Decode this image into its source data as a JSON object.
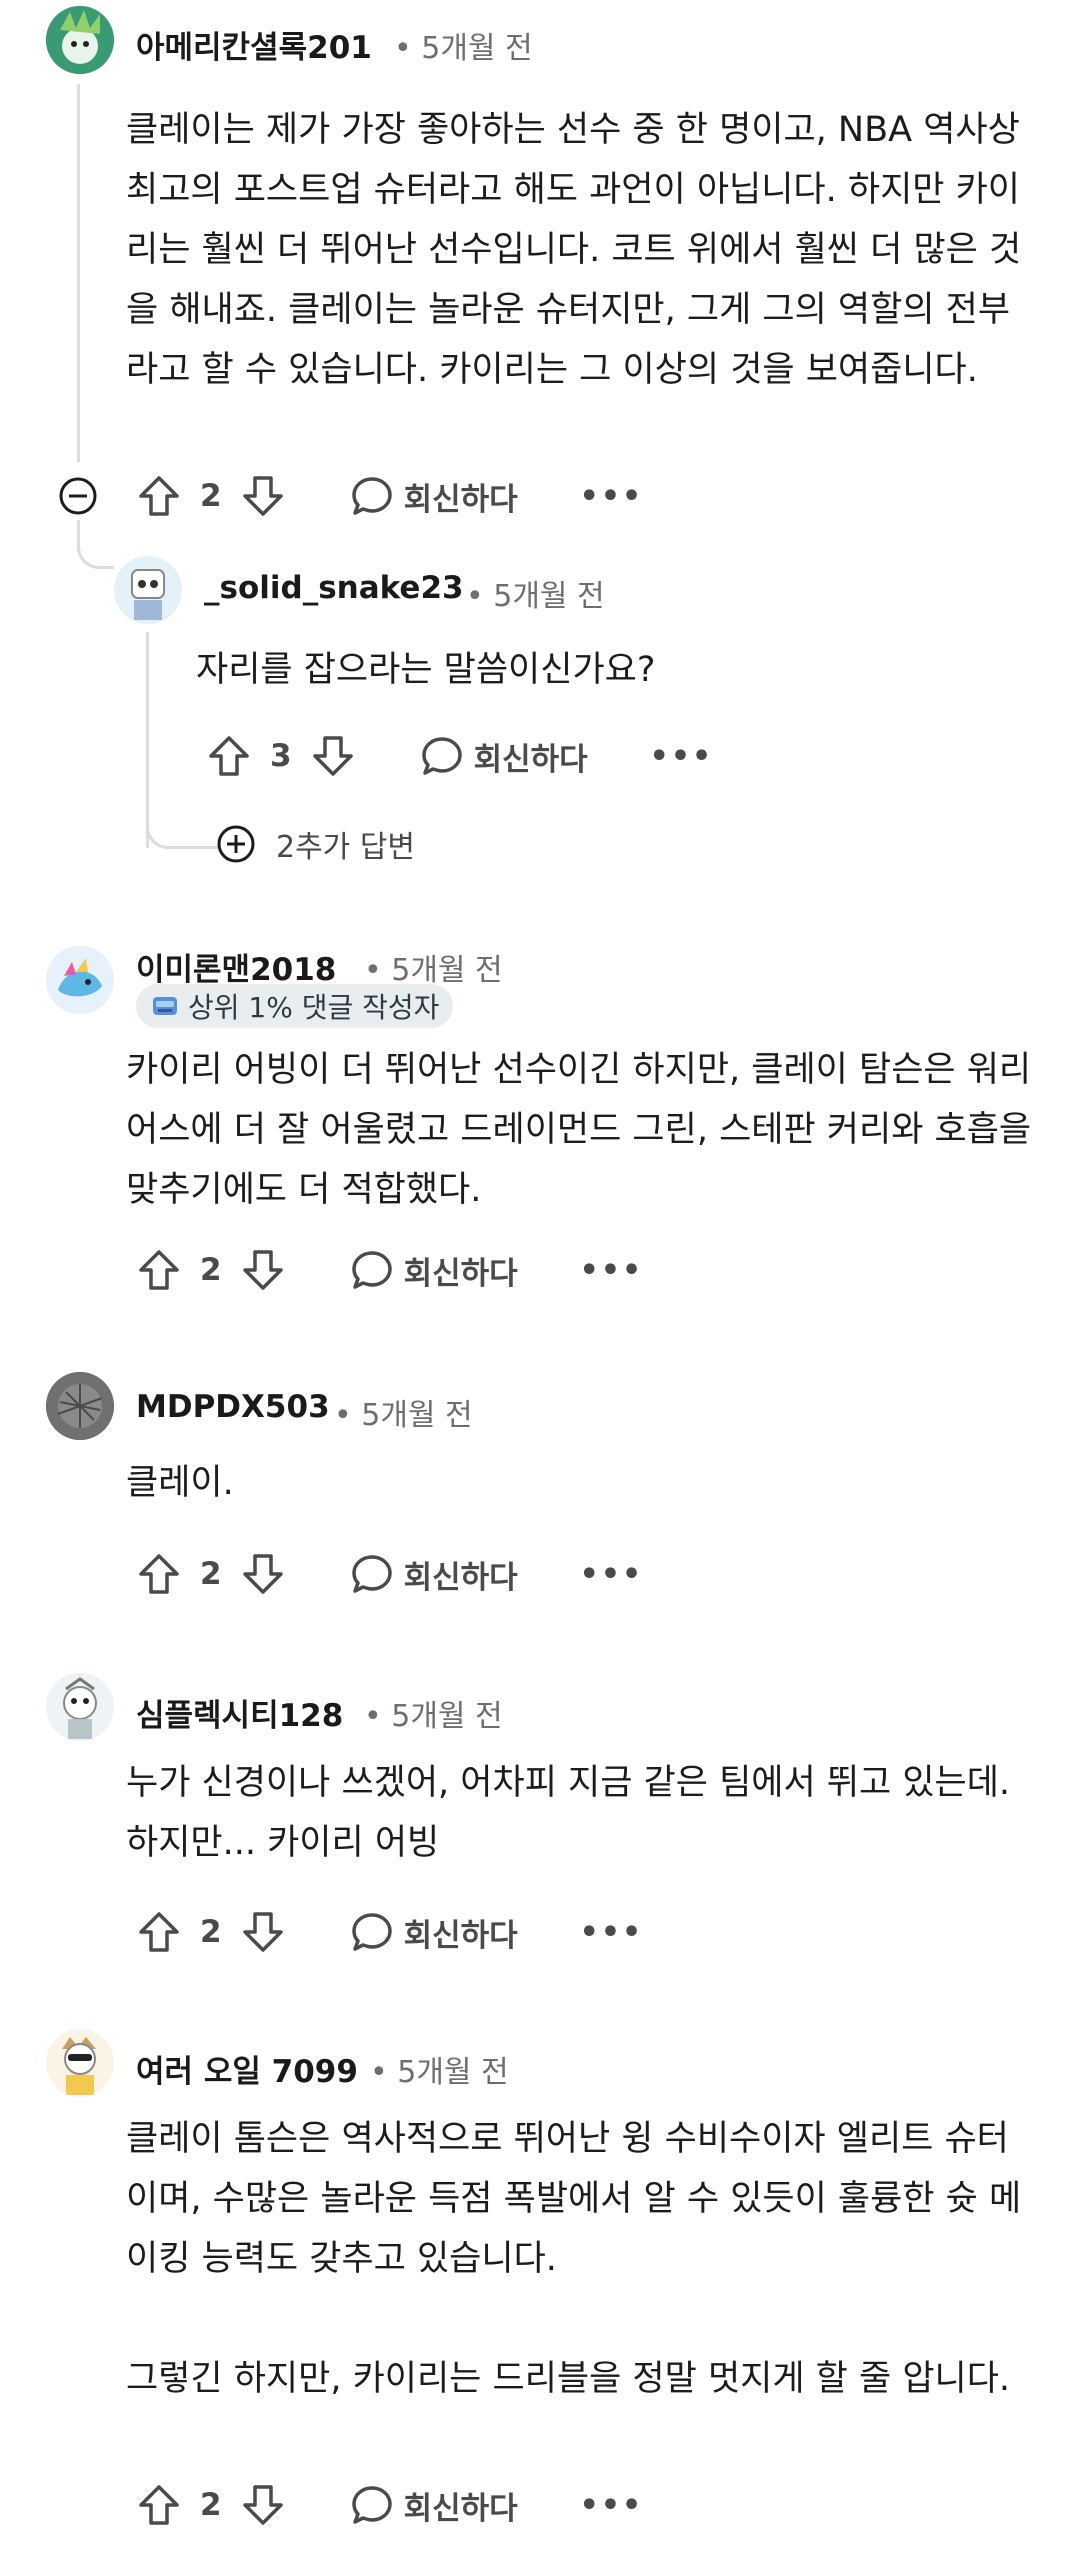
{
  "comments": [
    {
      "author": "아메리칸셜록201",
      "time": "• 5개월 전",
      "text": "클레이는 제가 가장 좋아하는 선수 중 한 명이고, NBA 역사상 최고의 포스트업 슈터라고 해도 과언이 아닙니다. 하지만 카이리는 훨씬 더 뛰어난 선수입니다. 코트 위에서 훨씬 더 많은 것을 해내죠. 클레이는 놀라운 슈터지만, 그게 그의 역할의 전부라고 할 수 있습니다. 카이리는 그 이상의 것을 보여줍니다.",
      "votes": "2",
      "reply_label": "회신하다",
      "more": "•••"
    },
    {
      "author": "_solid_snake23",
      "time": "• 5개월 전",
      "text": "자리를 잡으라는 말씀이신가요?",
      "votes": "3",
      "reply_label": "회신하다",
      "more": "•••",
      "more_replies": "2추가 답변"
    },
    {
      "author": "이미론맨2018",
      "time": "• 5개월 전",
      "flair": "상위 1% 댓글 작성자",
      "text": "카이리 어빙이 더 뛰어난 선수이긴 하지만, 클레이 탐슨은 워리어스에 더 잘 어울렸고 드레이먼드 그린, 스테판 커리와 호흡을 맞추기에도 더 적합했다.",
      "votes": "2",
      "reply_label": "회신하다",
      "more": "•••"
    },
    {
      "author": "MDPDX503",
      "time": "• 5개월 전",
      "text": "클레이.",
      "votes": "2",
      "reply_label": "회신하다",
      "more": "•••"
    },
    {
      "author": "심플렉시티128",
      "time": "• 5개월 전",
      "text": "누가 신경이나 쓰겠어, 어차피 지금 같은 팀에서 뛰고 있는데. 하지만... 카이리 어빙",
      "votes": "2",
      "reply_label": "회신하다",
      "more": "•••"
    },
    {
      "author": "여러 오일 7099",
      "time": "• 5개월 전",
      "text": "클레이 톰슨은 역사적으로 뛰어난 윙 수비수이자 엘리트 슈터이며, 수많은 놀라운 득점 폭발에서 알 수 있듯이 훌륭한 슛 메이킹 능력도 갖추고 있습니다.",
      "text2": "그렇긴 하지만, 카이리는 드리블을 정말 멋지게 할 줄 압니다.",
      "votes": "2",
      "reply_label": "회신하다",
      "more": "•••"
    }
  ],
  "icons": {
    "upvote": "upvote-arrow-icon",
    "downvote": "downvote-arrow-icon",
    "reply": "speech-bubble-icon",
    "collapse": "minus-circle-icon",
    "expand": "plus-circle-icon"
  },
  "colors": {
    "text": "#1c1c1c",
    "muted": "#6b6f72",
    "thread_line": "#dcdcdc",
    "flair_bg": "#eaedef"
  }
}
